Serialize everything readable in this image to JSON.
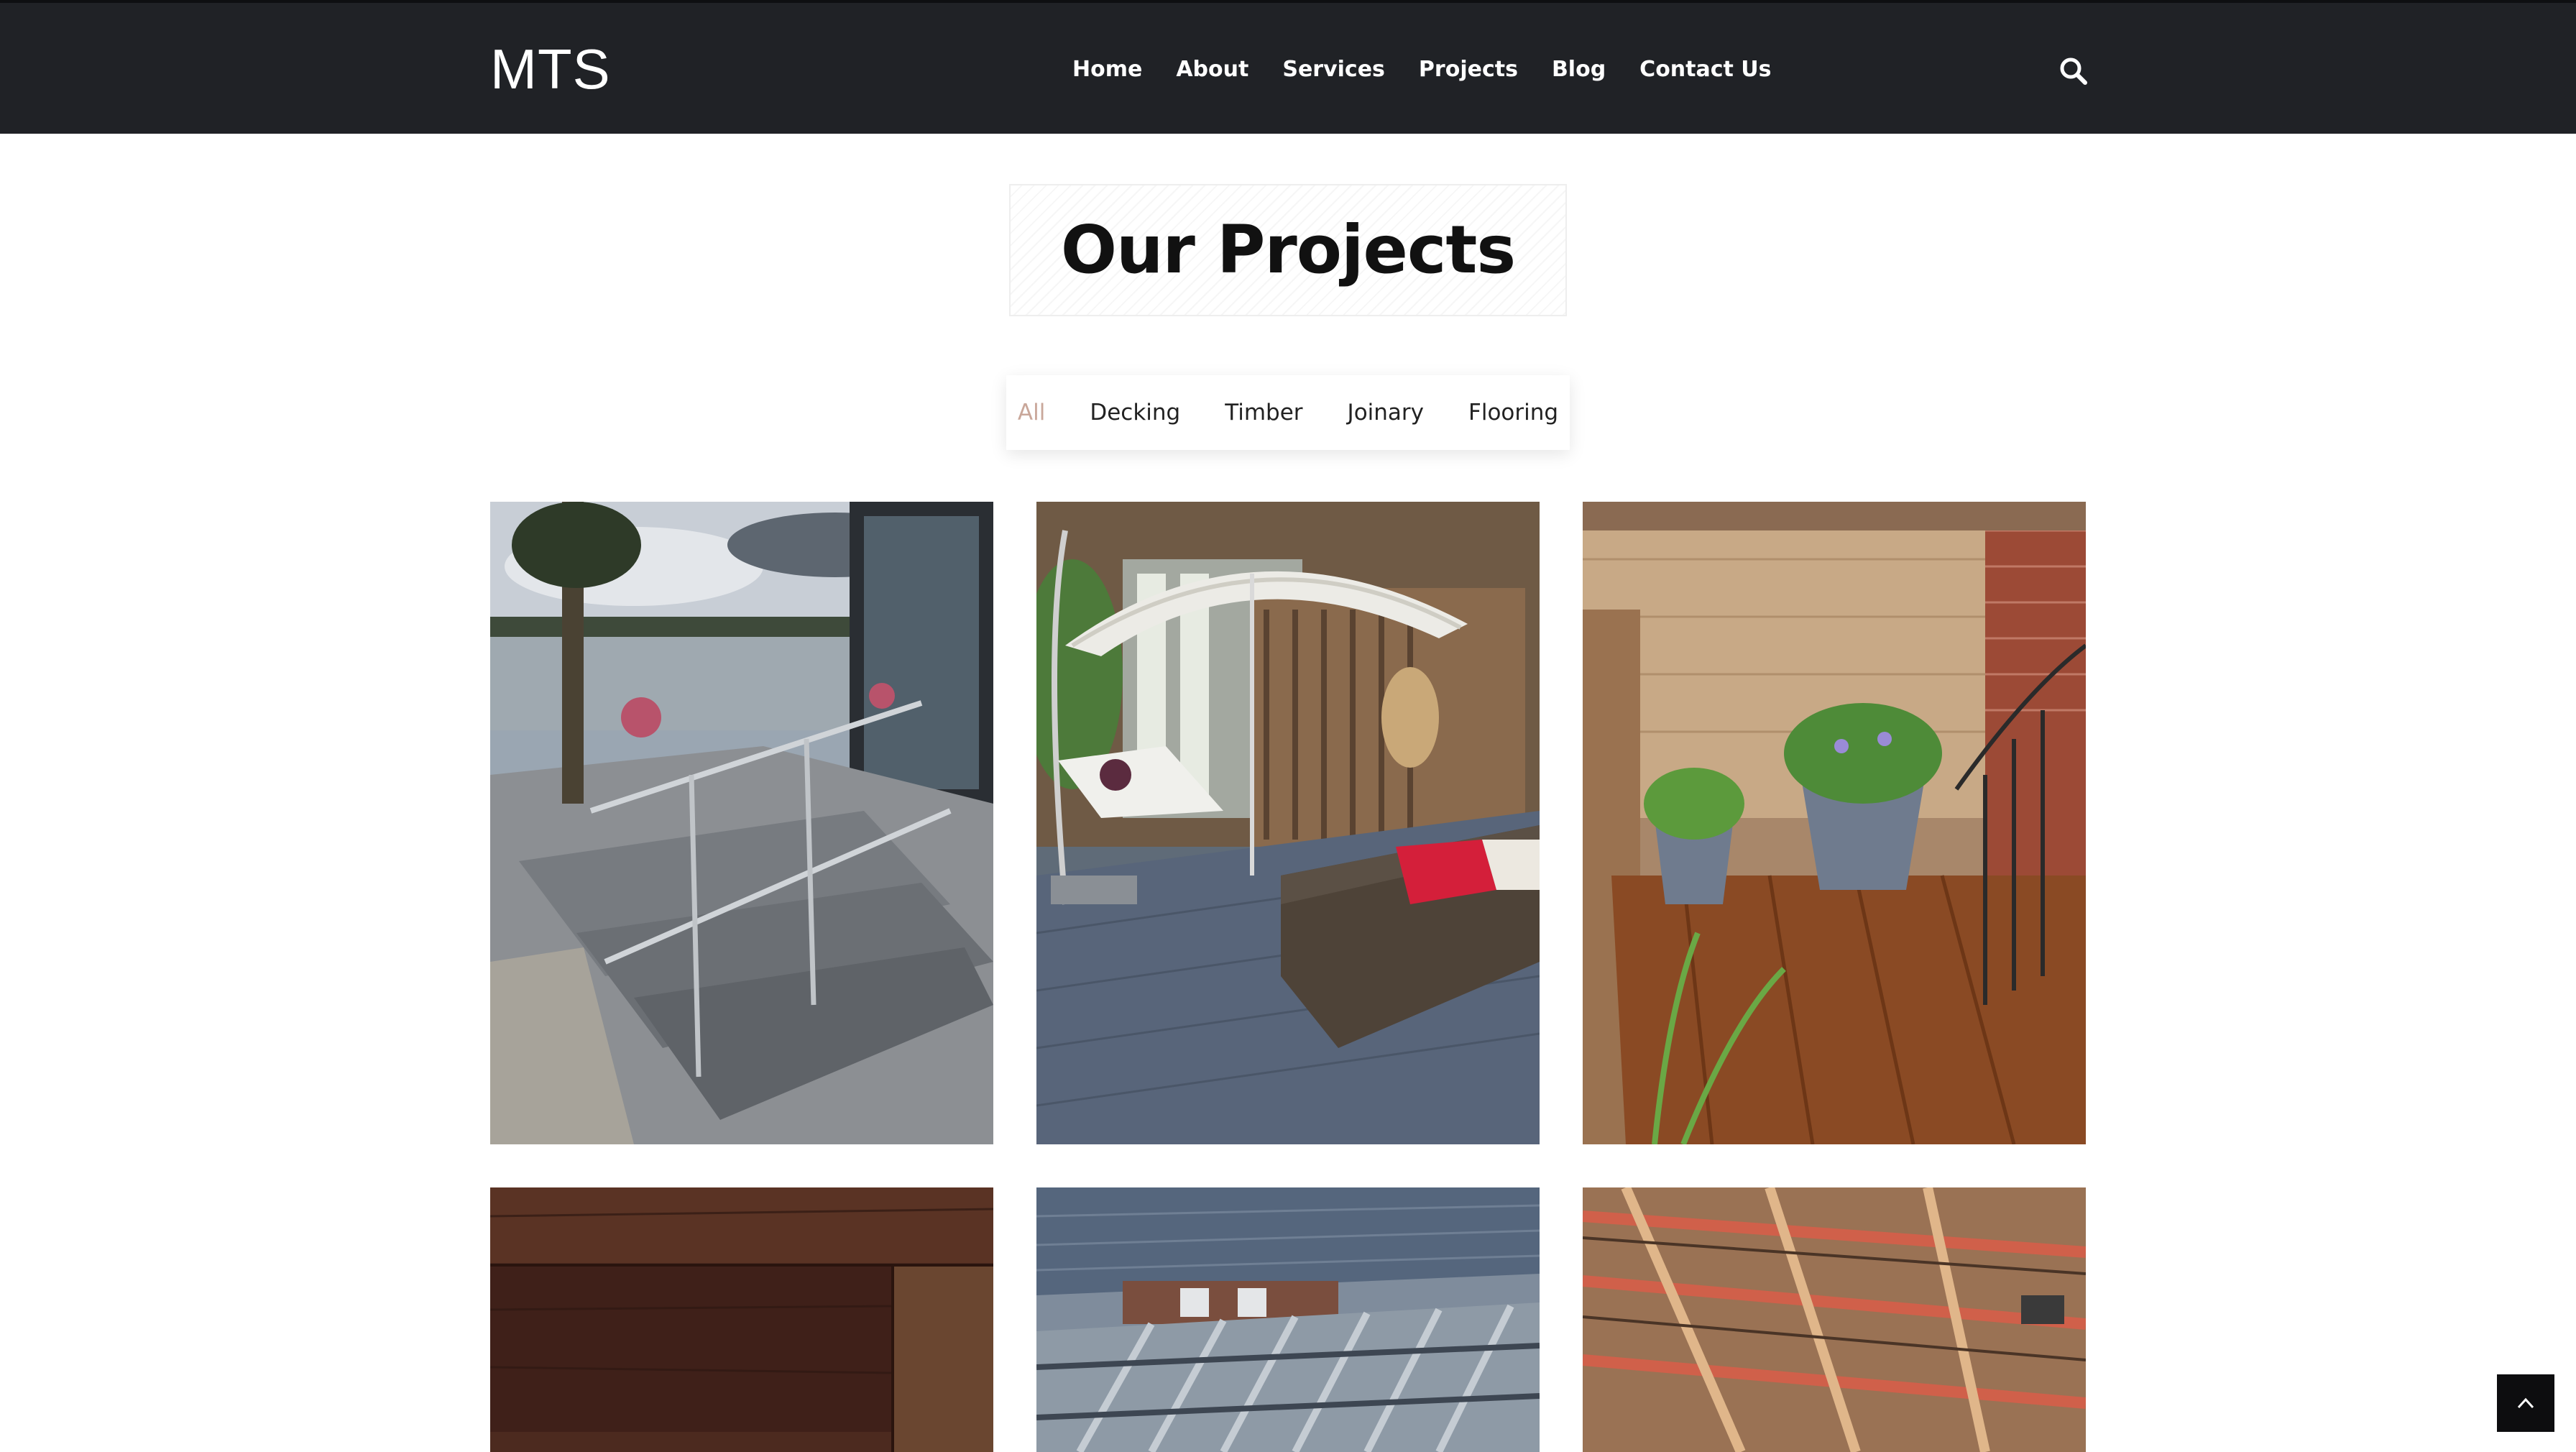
{
  "header": {
    "logo": "MTS",
    "nav": [
      "Home",
      "About",
      "Services",
      "Projects",
      "Blog",
      "Contact Us"
    ],
    "search_icon": "search-icon"
  },
  "section": {
    "title": "Our Projects"
  },
  "filters": {
    "items": [
      "All",
      "Decking",
      "Timber",
      "Joinary",
      "Flooring"
    ],
    "active": "All",
    "active_color": "#c9a79a"
  },
  "gallery": {
    "items": [
      {
        "depicts": "grey composite deck stairs with glass railing by a lake"
      },
      {
        "depicts": "grey deck with parasol, loungers, hanging chair and rattan sofa"
      },
      {
        "depicts": "wooden balcony deck with potted plants and fence"
      },
      {
        "depicts": "dark walnut wood flooring planks"
      },
      {
        "depicts": "metal deck frame under construction"
      },
      {
        "depicts": "timber roof joists construction"
      }
    ]
  },
  "back_to_top": {
    "icon": "chevron-up-icon"
  },
  "colors": {
    "header_bg": "#202226",
    "active_filter": "#c9a79a",
    "back_to_top_bg": "#0d0d0f"
  }
}
